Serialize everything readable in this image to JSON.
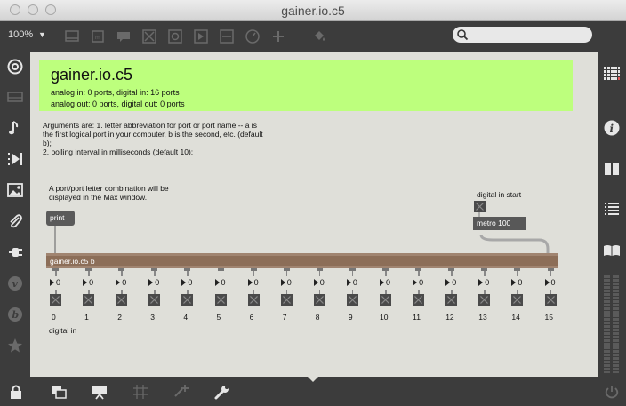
{
  "window": {
    "title": "gainer.io.c5"
  },
  "toolbar": {
    "zoom": "100%",
    "icons": [
      "presentation-icon",
      "text-icon",
      "comment-icon",
      "button-icon",
      "toggle-icon",
      "play-icon",
      "slider-icon",
      "dial-icon",
      "plus-icon",
      "paint-bucket-icon"
    ],
    "search_placeholder": ""
  },
  "left_sidebar": {
    "icons": [
      "target-icon",
      "keyboard-icon",
      "music-note-icon",
      "video-icon",
      "image-icon",
      "paperclip-icon",
      "plug-icon",
      "v8-icon",
      "beap-icon",
      "star-icon"
    ]
  },
  "right_sidebar": {
    "icons": [
      "grid-icon",
      "info-icon",
      "book-icon",
      "list-icon",
      "reference-icon"
    ]
  },
  "bottom_bar": {
    "icons": [
      "lock-icon",
      "presentation-icon",
      "present-mode-icon",
      "grid-icon",
      "new-object-icon",
      "wrench-icon",
      "power-icon"
    ]
  },
  "patch": {
    "header": {
      "title": "gainer.io.c5",
      "line1": "analog in: 0 ports, digital in: 16 ports",
      "line2": "analog out: 0 ports, digital out: 0 ports"
    },
    "arguments_comment": {
      "line1": "Arguments are: 1. letter abbreviation for port or port name -- a is",
      "line2": "the first logical port in your computer, b is the second, etc. (default",
      "line3": "b);",
      "line4": "2. polling interval in milliseconds (default 10);"
    },
    "port_comment": {
      "line1": "A port/port letter combination will be",
      "line2": "displayed in the Max window."
    },
    "print_message": "print",
    "digital_in_start_label": "digital in start",
    "metro_object": "metro 100",
    "main_object": "gainer.io.c5 b",
    "channel_values": [
      "0",
      "0",
      "0",
      "0",
      "0",
      "0",
      "0",
      "0",
      "0",
      "0",
      "0",
      "0",
      "0",
      "0",
      "0",
      "0"
    ],
    "channel_labels": [
      "0",
      "1",
      "2",
      "3",
      "4",
      "5",
      "6",
      "7",
      "8",
      "9",
      "10",
      "11",
      "12",
      "13",
      "14",
      "15"
    ],
    "digital_in_label": "digital in"
  },
  "colors": {
    "header_bg": "#bdff7d",
    "canvas_bg": "#dfdfd9",
    "chrome_bg": "#3c3c3c",
    "main_object": "#8c6e58"
  }
}
